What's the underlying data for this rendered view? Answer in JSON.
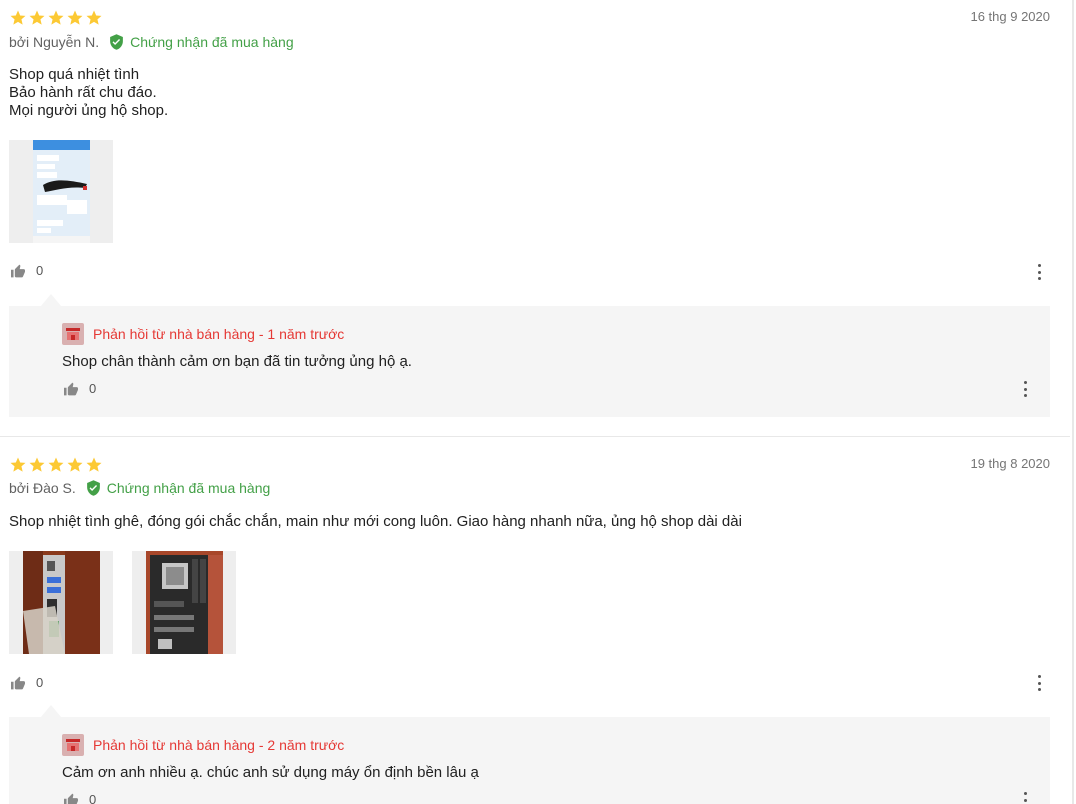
{
  "reviews": [
    {
      "rating": 5,
      "date": "16 thg 9 2020",
      "author": "bởi Nguyễn N.",
      "verified_label": "Chứng nhận đã mua hàng",
      "comment_lines": [
        "Shop quá nhiệt tình",
        "Bảo hành rất chu đáo.",
        "Mọi người ủng hộ shop."
      ],
      "photos": [
        "chat-screenshot"
      ],
      "likes": "0",
      "reply": {
        "header": "Phản hồi từ nhà bán hàng - 1 năm trước",
        "text": "Shop chân thành cảm ơn bạn đã tin tưởng ủng hộ ạ.",
        "likes": "0"
      }
    },
    {
      "rating": 5,
      "date": "19 thg 8 2020",
      "author": "bởi Đào S.",
      "verified_label": "Chứng nhận đã mua hàng",
      "comment_lines": [
        "Shop nhiệt tình ghê, đóng gói chắc chắn, main như mới cong luôn. Giao hàng nhanh nữa, ủng hộ shop dài dài"
      ],
      "photos": [
        "motherboard-side",
        "motherboard-top"
      ],
      "likes": "0",
      "reply": {
        "header": "Phản hồi từ nhà bán hàng - 2 năm trước",
        "text": "Cảm ơn anh nhiều ạ. chúc anh sử dụng máy ổn định bền lâu ạ",
        "likes": "0"
      }
    }
  ],
  "colors": {
    "star": "#fcc934",
    "verified": "#43a047",
    "reply_header": "#e53935",
    "reply_bg": "#f5f5f5"
  },
  "icons": {
    "star": "star-icon",
    "verified": "shield-check-icon",
    "like": "thumbs-up-icon",
    "more": "more-vertical-icon",
    "shop": "shop-icon"
  }
}
